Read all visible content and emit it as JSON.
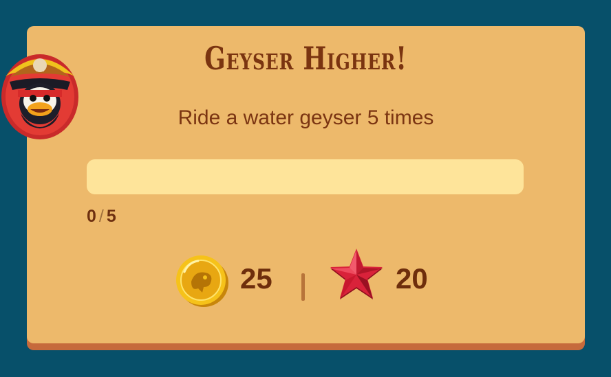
{
  "challenge": {
    "title": "Geyser Higher!",
    "description": "Ride a water geyser 5 times",
    "progress": {
      "current": "0",
      "separator": "/",
      "total": "5",
      "fraction": 0
    }
  },
  "rewards": {
    "coins": {
      "icon": "coin-icon",
      "value": "25"
    },
    "stars": {
      "icon": "red-star-icon",
      "value": "20"
    }
  },
  "colors": {
    "background": "#07506a",
    "card": "#edb96b",
    "card_shadow": "#c66a3c",
    "progress_track": "#fee49a",
    "text_dark": "#7a3410"
  }
}
